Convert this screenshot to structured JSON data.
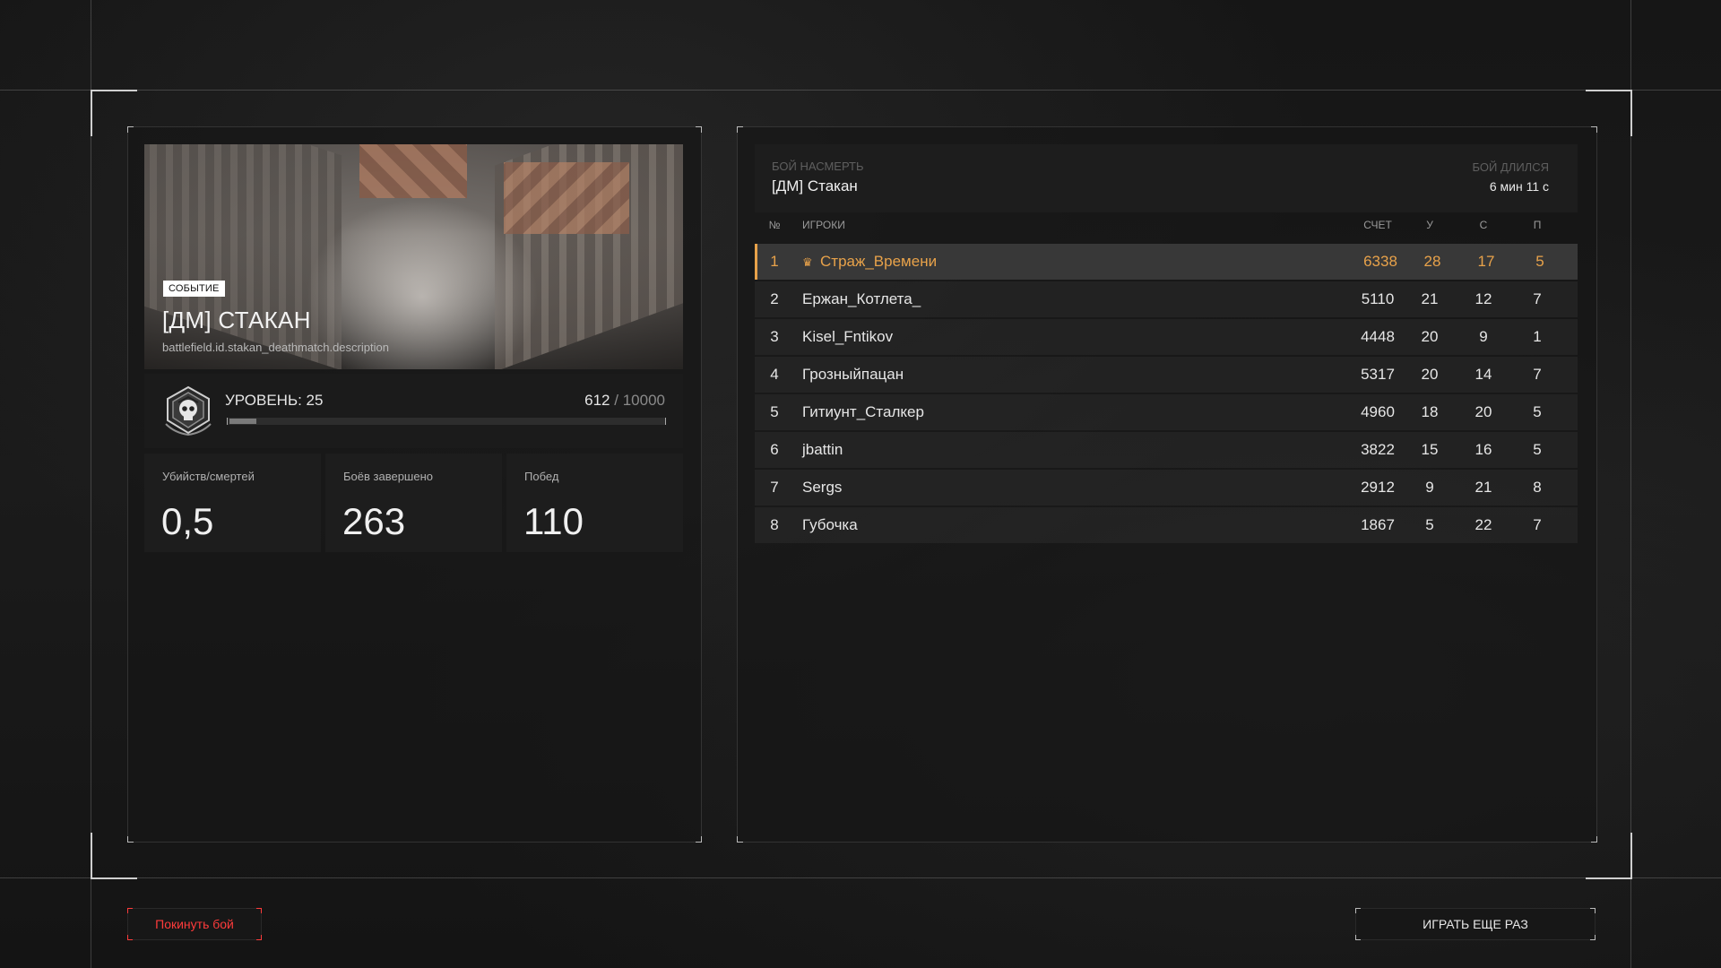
{
  "event": {
    "badge": "СОБЫТИЕ",
    "map_title": "[ДМ] СТАКАН",
    "map_description": "battlefield.id.stakan_deathmatch.description"
  },
  "level": {
    "label": "УРОВЕНЬ: 25",
    "xp_current": "612",
    "xp_separator": "/",
    "xp_max": "10000",
    "progress": 0.0612
  },
  "stats": [
    {
      "label": "Убийств/смертей",
      "value": "0,5"
    },
    {
      "label": "Боёв завершено",
      "value": "263"
    },
    {
      "label": "Побед",
      "value": "110"
    }
  ],
  "match": {
    "mode_label": "БОЙ НАСМЕРТЬ",
    "mode_name": "[ДМ] Стакан",
    "duration_label": "БОЙ ДЛИЛСЯ",
    "duration_value": "6 мин 11 с"
  },
  "table": {
    "headers": {
      "rank": "№",
      "players": "ИГРОКИ",
      "score": "СЧЕТ",
      "kills": "У",
      "deaths": "С",
      "assists": "П"
    },
    "rows": [
      {
        "rank": "1",
        "name": "Страж_Времени",
        "score": "6338",
        "kills": "28",
        "deaths": "17",
        "assists": "5",
        "highlight": true
      },
      {
        "rank": "2",
        "name": "Ержан_Котлета_",
        "score": "5110",
        "kills": "21",
        "deaths": "12",
        "assists": "7"
      },
      {
        "rank": "3",
        "name": "Kisel_Fntikov",
        "score": "4448",
        "kills": "20",
        "deaths": "9",
        "assists": "1"
      },
      {
        "rank": "4",
        "name": "Грозныйпацан",
        "score": "5317",
        "kills": "20",
        "deaths": "14",
        "assists": "7"
      },
      {
        "rank": "5",
        "name": "Гитиунт_Сталкер",
        "score": "4960",
        "kills": "18",
        "deaths": "20",
        "assists": "5"
      },
      {
        "rank": "6",
        "name": "jbattin",
        "score": "3822",
        "kills": "15",
        "deaths": "16",
        "assists": "5"
      },
      {
        "rank": "7",
        "name": "Sergs",
        "score": "2912",
        "kills": "9",
        "deaths": "21",
        "assists": "8"
      },
      {
        "rank": "8",
        "name": "Губочка",
        "score": "1867",
        "kills": "5",
        "deaths": "22",
        "assists": "7"
      }
    ]
  },
  "buttons": {
    "leave": "Покинуть бой",
    "play_again": "ИГРАТЬ ЕЩЕ РАЗ"
  },
  "colors": {
    "accent": "#e8a24a",
    "danger": "#ff3b3b"
  },
  "icons": {
    "emblem": "skull-shield-icon",
    "leader": "crown-icon"
  }
}
